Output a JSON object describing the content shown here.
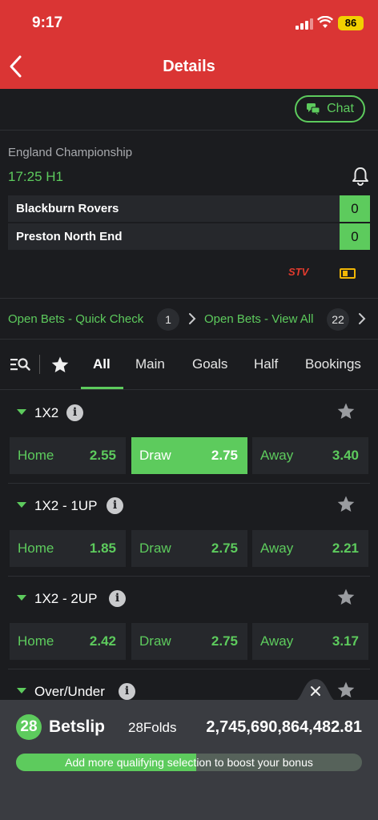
{
  "status_bar": {
    "time": "9:17",
    "battery": "86"
  },
  "header": {
    "title": "Details"
  },
  "chat": {
    "label": "Chat"
  },
  "match": {
    "league": "England Championship",
    "clock": "17:25 H1",
    "teams": [
      {
        "name": "Blackburn Rovers",
        "score": "0"
      },
      {
        "name": "Preston North End",
        "score": "0"
      }
    ],
    "stv_label": "STV"
  },
  "open_bets": {
    "quick_check": {
      "label": "Open Bets - Quick Check",
      "count": "1"
    },
    "view_all": {
      "label": "Open Bets - View All",
      "count": "22"
    }
  },
  "tabs": {
    "all": "All",
    "main": "Main",
    "goals": "Goals",
    "half": "Half",
    "bookings": "Bookings"
  },
  "markets": [
    {
      "name": "1X2",
      "odds": [
        {
          "label": "Home",
          "value": "2.55"
        },
        {
          "label": "Draw",
          "value": "2.75",
          "selected": true
        },
        {
          "label": "Away",
          "value": "3.40"
        }
      ]
    },
    {
      "name": "1X2 - 1UP",
      "odds": [
        {
          "label": "Home",
          "value": "1.85"
        },
        {
          "label": "Draw",
          "value": "2.75"
        },
        {
          "label": "Away",
          "value": "2.21"
        }
      ]
    },
    {
      "name": "1X2 - 2UP",
      "odds": [
        {
          "label": "Home",
          "value": "2.42"
        },
        {
          "label": "Draw",
          "value": "2.75"
        },
        {
          "label": "Away",
          "value": "3.17"
        }
      ]
    },
    {
      "name": "Over/Under"
    }
  ],
  "betslip": {
    "count": "28",
    "label": "Betslip",
    "folds": "28Folds",
    "payout": "2,745,690,864,482.81",
    "bonus_text": "Add more qualifying selection to boost your bonus",
    "bonus_progress": 0.52
  },
  "colors": {
    "header": "#da3534",
    "accent": "#5dcb5d",
    "background": "#1b1c1f"
  },
  "icons": [
    "back-arrow-icon",
    "chat-icon",
    "bell-icon",
    "stv-icon",
    "ticket-icon",
    "search-list-icon",
    "star-icon",
    "info-icon",
    "chevron-right-icon",
    "close-icon"
  ]
}
